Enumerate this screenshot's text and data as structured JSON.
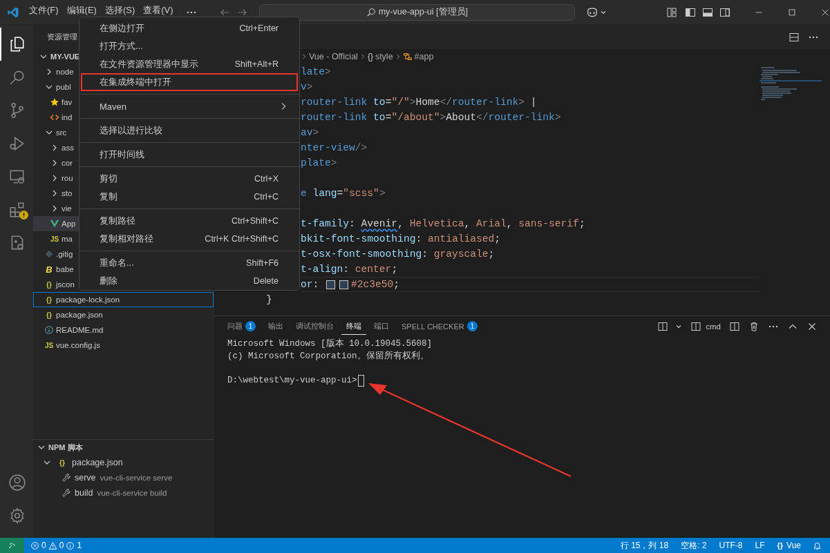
{
  "titlebar": {
    "menus": [
      "文件(F)",
      "编辑(E)",
      "选择(S)",
      "查看(V)"
    ],
    "search": "my-vue-app-ui [管理员]",
    "layout_toggles": [
      {
        "kind": "sidebar",
        "on": true
      },
      {
        "kind": "panel",
        "on": true
      },
      {
        "kind": "secondary",
        "on": false
      }
    ]
  },
  "activity_bar": {
    "top": [
      {
        "kind": "explorer",
        "selected": true,
        "warning": false
      },
      {
        "kind": "search",
        "selected": false,
        "warning": false
      },
      {
        "kind": "scm",
        "selected": false,
        "warning": false
      },
      {
        "kind": "debug",
        "selected": false,
        "warning": false
      },
      {
        "kind": "remote",
        "selected": false,
        "warning": false
      },
      {
        "kind": "extensions",
        "selected": false,
        "warning": true
      },
      {
        "kind": "testing",
        "selected": false,
        "warning": false
      }
    ],
    "bottom": [
      {
        "kind": "account"
      },
      {
        "kind": "settings"
      }
    ]
  },
  "sidebar": {
    "title": "资源管理",
    "tree": [
      {
        "label": "MY-VUE",
        "kind": "folder",
        "expanded": true,
        "selected": false,
        "focused": false,
        "children": [
          {
            "label": "node",
            "kind": "folder",
            "expanded": false,
            "selected": false,
            "focused": false
          },
          {
            "label": "publ",
            "kind": "folder",
            "expanded": true,
            "selected": false,
            "focused": false,
            "children": [
              {
                "label": "fav",
                "kind": "star",
                "selected": false,
                "focused": false
              },
              {
                "label": "ind",
                "kind": "html",
                "selected": false,
                "focused": false
              }
            ]
          },
          {
            "label": "src",
            "kind": "folder",
            "expanded": true,
            "selected": false,
            "focused": false,
            "children": [
              {
                "label": "ass",
                "kind": "folder",
                "expanded": false,
                "selected": false,
                "focused": false
              },
              {
                "label": "cor",
                "kind": "folder",
                "expanded": false,
                "selected": false,
                "focused": false
              },
              {
                "label": "rou",
                "kind": "folder",
                "expanded": false,
                "selected": false,
                "focused": false
              },
              {
                "label": "sto",
                "kind": "folder",
                "expanded": false,
                "selected": false,
                "focused": false
              },
              {
                "label": "vie",
                "kind": "folder",
                "expanded": false,
                "selected": false,
                "focused": false
              },
              {
                "label": "App",
                "kind": "vue",
                "selected": true,
                "focused": false
              },
              {
                "label": "ma",
                "kind": "js",
                "icon_text": "JS",
                "selected": false,
                "focused": false
              }
            ]
          },
          {
            "label": ".gitig",
            "kind": "git",
            "selected": false,
            "focused": false
          },
          {
            "label": "babe",
            "kind": "babel",
            "icon_text": "B",
            "selected": false,
            "focused": false
          },
          {
            "label": "jscon",
            "kind": "json",
            "icon_text": "{}",
            "selected": false,
            "focused": false
          },
          {
            "label": "package-lock.json",
            "kind": "json",
            "icon_text": "{}",
            "selected": false,
            "focused": true
          },
          {
            "label": "package.json",
            "kind": "json",
            "icon_text": "{}",
            "selected": false,
            "focused": false
          },
          {
            "label": "README.md",
            "kind": "info",
            "selected": false,
            "focused": false
          },
          {
            "label": "vue.config.js",
            "kind": "js",
            "icon_text": "JS",
            "selected": false,
            "focused": false
          }
        ]
      }
    ],
    "npm": {
      "title": "NPM 脚本",
      "expanded": true,
      "file": {
        "label": "package.json",
        "icon_text": "{}",
        "expanded": true
      },
      "scripts": [
        {
          "name": "serve",
          "command": "vue-cli-service serve"
        },
        {
          "name": "build",
          "command": "vue-cli-service build"
        }
      ]
    }
  },
  "editor": {
    "breadcrumbs": [
      {
        "label": "Vue - Official",
        "kind": "plain"
      },
      {
        "label": "style",
        "kind": "braces",
        "icon_text": "{}"
      },
      {
        "label": "#app",
        "kind": "selector"
      }
    ],
    "lines": [
      {
        "kind": "cut",
        "current": false,
        "tokens": [
          {
            "text": "late",
            "kind": "tag"
          },
          {
            "text": ">",
            "kind": "punct"
          }
        ]
      },
      {
        "kind": "cut",
        "current": false,
        "tokens": [
          {
            "text": "v",
            "kind": "tag"
          },
          {
            "text": ">",
            "kind": "punct"
          }
        ]
      },
      {
        "kind": "cut",
        "current": false,
        "tokens": [
          {
            "text": "router-link",
            "kind": "tag"
          },
          {
            "text": " to",
            "kind": "attr"
          },
          {
            "text": "=",
            "kind": "plain"
          },
          {
            "text": "\"/\"",
            "kind": "str"
          },
          {
            "text": ">",
            "kind": "punct"
          },
          {
            "text": "Home",
            "kind": "plain"
          },
          {
            "text": "</",
            "kind": "punct"
          },
          {
            "text": "router-link",
            "kind": "tag"
          },
          {
            "text": ">",
            "kind": "punct"
          },
          {
            "text": " |",
            "kind": "plain"
          }
        ]
      },
      {
        "kind": "cut",
        "current": false,
        "tokens": [
          {
            "text": "router-link",
            "kind": "tag"
          },
          {
            "text": " to",
            "kind": "attr"
          },
          {
            "text": "=",
            "kind": "plain"
          },
          {
            "text": "\"/about\"",
            "kind": "str"
          },
          {
            "text": ">",
            "kind": "punct"
          },
          {
            "text": "About",
            "kind": "plain"
          },
          {
            "text": "</",
            "kind": "punct"
          },
          {
            "text": "router-link",
            "kind": "tag"
          },
          {
            "text": ">",
            "kind": "punct"
          }
        ]
      },
      {
        "kind": "cut",
        "current": false,
        "tokens": [
          {
            "text": "av",
            "kind": "tag"
          },
          {
            "text": ">",
            "kind": "punct"
          }
        ]
      },
      {
        "kind": "cut",
        "current": false,
        "tokens": [
          {
            "text": "nter-view",
            "kind": "tag"
          },
          {
            "text": "/>",
            "kind": "punct"
          }
        ]
      },
      {
        "kind": "cut",
        "current": false,
        "tokens": [
          {
            "text": "plate",
            "kind": "tag"
          },
          {
            "text": ">",
            "kind": "punct"
          }
        ]
      },
      {
        "kind": "blank"
      },
      {
        "kind": "cut",
        "current": false,
        "tokens": [
          {
            "text": "e",
            "kind": "tag"
          },
          {
            "text": " lang",
            "kind": "attr"
          },
          {
            "text": "=",
            "kind": "plain"
          },
          {
            "text": "\"scss\"",
            "kind": "str"
          },
          {
            "text": ">",
            "kind": "punct"
          }
        ]
      },
      {
        "kind": "blank"
      },
      {
        "kind": "cut",
        "current": false,
        "tokens": [
          {
            "text": "t-family",
            "kind": "prop"
          },
          {
            "text": ": ",
            "kind": "plain"
          },
          {
            "text": "Avenir",
            "kind": "warn"
          },
          {
            "text": ", ",
            "kind": "plain"
          },
          {
            "text": "Helvetica",
            "kind": "str"
          },
          {
            "text": ", ",
            "kind": "plain"
          },
          {
            "text": "Arial",
            "kind": "str"
          },
          {
            "text": ", ",
            "kind": "plain"
          },
          {
            "text": "sans-serif",
            "kind": "str"
          },
          {
            "text": ";",
            "kind": "plain"
          }
        ]
      },
      {
        "kind": "cut",
        "current": false,
        "tokens": [
          {
            "text": "bkit-font-smoothing",
            "kind": "prop"
          },
          {
            "text": ": ",
            "kind": "plain"
          },
          {
            "text": "antialiased",
            "kind": "str"
          },
          {
            "text": ";",
            "kind": "plain"
          }
        ]
      },
      {
        "kind": "cut",
        "current": false,
        "tokens": [
          {
            "text": "t-osx-font-smoothing",
            "kind": "prop"
          },
          {
            "text": ": ",
            "kind": "plain"
          },
          {
            "text": "grayscale",
            "kind": "str"
          },
          {
            "text": ";",
            "kind": "plain"
          }
        ]
      },
      {
        "kind": "cut",
        "current": false,
        "tokens": [
          {
            "text": "t-align",
            "kind": "prop"
          },
          {
            "text": ": ",
            "kind": "plain"
          },
          {
            "text": "center",
            "kind": "str"
          },
          {
            "text": ";",
            "kind": "plain"
          }
        ]
      },
      {
        "kind": "cut",
        "current": true,
        "tokens": [
          {
            "text": "or",
            "kind": "prop"
          },
          {
            "text": ": ",
            "kind": "plain"
          },
          {
            "kind": "swatch",
            "color": "#2c3e50"
          },
          {
            "kind": "swatch",
            "color": "#2c3e50"
          },
          {
            "text": "#2c3e50",
            "kind": "str"
          },
          {
            "text": ";",
            "kind": "plain"
          }
        ]
      },
      {
        "kind": "full",
        "current": false,
        "tokens": [
          {
            "text": "}",
            "kind": "plain"
          }
        ]
      }
    ]
  },
  "panel": {
    "tabs": [
      {
        "label": "问题",
        "badge": "1",
        "selected": false
      },
      {
        "label": "输出",
        "selected": false
      },
      {
        "label": "调试控制台",
        "selected": false
      },
      {
        "label": "终端",
        "selected": true
      },
      {
        "label": "端口",
        "selected": false
      },
      {
        "label": "SPELL CHECKER",
        "badge": "1",
        "selected": false
      }
    ],
    "shell": "cmd",
    "output": [
      "Microsoft Windows [版本 10.0.19045.5608]",
      "(c) Microsoft Corporation。保留所有权利。"
    ],
    "prompt": "D:\\webtest\\my-vue-app-ui>"
  },
  "context_menu": {
    "groups": [
      [
        {
          "label": "在侧边打开",
          "shortcut": "Ctrl+Enter",
          "submenu": false,
          "marked": false
        },
        {
          "label": "打开方式...",
          "submenu": false,
          "marked": false
        },
        {
          "label": "在文件资源管理器中显示",
          "shortcut": "Shift+Alt+R",
          "submenu": false,
          "marked": false
        },
        {
          "label": "在集成终端中打开",
          "submenu": false,
          "marked": true
        }
      ],
      [
        {
          "label": "Maven",
          "submenu": true,
          "marked": false
        }
      ],
      [
        {
          "label": "选择以进行比较",
          "submenu": false,
          "marked": false
        }
      ],
      [
        {
          "label": "打开时间线",
          "submenu": false,
          "marked": false
        }
      ],
      [
        {
          "label": "剪切",
          "shortcut": "Ctrl+X",
          "submenu": false,
          "marked": false
        },
        {
          "label": "复制",
          "shortcut": "Ctrl+C",
          "submenu": false,
          "marked": false
        }
      ],
      [
        {
          "label": "复制路径",
          "shortcut": "Ctrl+Shift+C",
          "submenu": false,
          "marked": false
        },
        {
          "label": "复制相对路径",
          "shortcut": "Ctrl+K Ctrl+Shift+C",
          "submenu": false,
          "marked": false
        }
      ],
      [
        {
          "label": "重命名...",
          "shortcut": "Shift+F6",
          "submenu": false,
          "marked": false
        },
        {
          "label": "删除",
          "shortcut": "Delete",
          "submenu": false,
          "marked": false
        }
      ]
    ]
  },
  "status_bar": {
    "errors": "0",
    "warnings": "0",
    "infos": "1",
    "right": [
      "行 15，列 18",
      "空格: 2",
      "UTF-8",
      "LF"
    ],
    "language_icon": "{}",
    "language": "Vue"
  }
}
